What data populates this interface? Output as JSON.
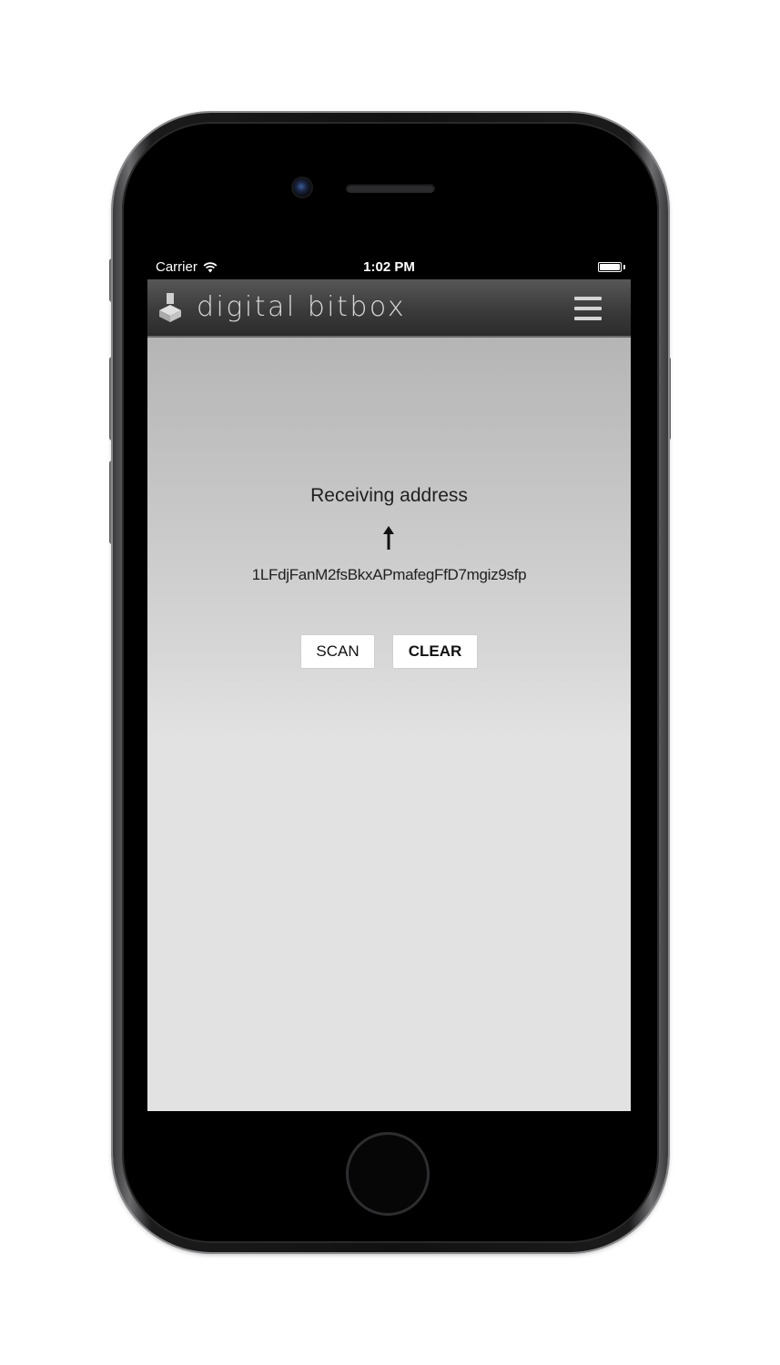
{
  "status_bar": {
    "carrier": "Carrier",
    "time": "1:02 PM"
  },
  "navbar": {
    "brand": "digital bitbox",
    "menu_icon": "hamburger-menu-icon"
  },
  "main": {
    "receiving_label": "Receiving address",
    "arrow_icon": "arrow-up-icon",
    "address": "1LFdjFanM2fsBkxAPmafegFfD7mgiz9sfp",
    "scan_label": "SCAN",
    "clear_label": "CLEAR"
  },
  "colors": {
    "navbar_bg": "#3b3b3b",
    "content_bg": "#e2e2e2",
    "button_bg": "#ffffff"
  }
}
